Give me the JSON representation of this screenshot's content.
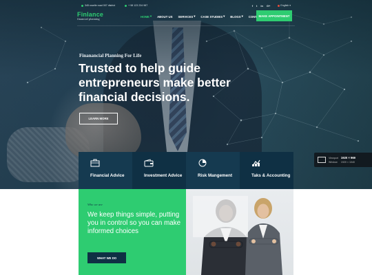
{
  "topbar": {
    "address": "345 roselle road 007 district",
    "phone": "+ 98 123 234 987",
    "social": [
      "f",
      "t",
      "in",
      "G+"
    ],
    "language": "English"
  },
  "brand": {
    "name": "Finlance",
    "tagline": "financial planning"
  },
  "nav": {
    "items": [
      {
        "label": "HOME",
        "active": true,
        "dropdown": true
      },
      {
        "label": "ABOUT US",
        "active": false,
        "dropdown": false
      },
      {
        "label": "SERVICES",
        "active": false,
        "dropdown": true
      },
      {
        "label": "CASE STUDIES",
        "active": false,
        "dropdown": true
      },
      {
        "label": "BLOGS",
        "active": false,
        "dropdown": true
      },
      {
        "label": "CONTACT",
        "active": false,
        "dropdown": false
      }
    ],
    "cta": "MAKE APPOINTMENT"
  },
  "hero": {
    "eyebrow": "Finanancial Planning For Life",
    "headline": "Trusted to help guide entrepreneurs make better financial decisions.",
    "button": "LEARN MORE"
  },
  "services": [
    {
      "label": "Financial Advice",
      "icon": "briefcase-icon"
    },
    {
      "label": "Investment Advice",
      "icon": "wallet-icon"
    },
    {
      "label": "Risk Mangement",
      "icon": "pie-chart-icon"
    },
    {
      "label": "Taks & Accounting",
      "icon": "calculator-icon"
    }
  ],
  "viewport_badge": {
    "label": "Viewport",
    "value": "1920 × 969",
    "sublabel": "Window",
    "subvalue": "1920 × 1040"
  },
  "about": {
    "eyebrow": "Who we are",
    "text": "We keep things simple, putting you in control so you can make informed choices",
    "button": "WHAT WE DO"
  },
  "colors": {
    "accent": "#2ecc71",
    "navy": "#0f3044"
  }
}
